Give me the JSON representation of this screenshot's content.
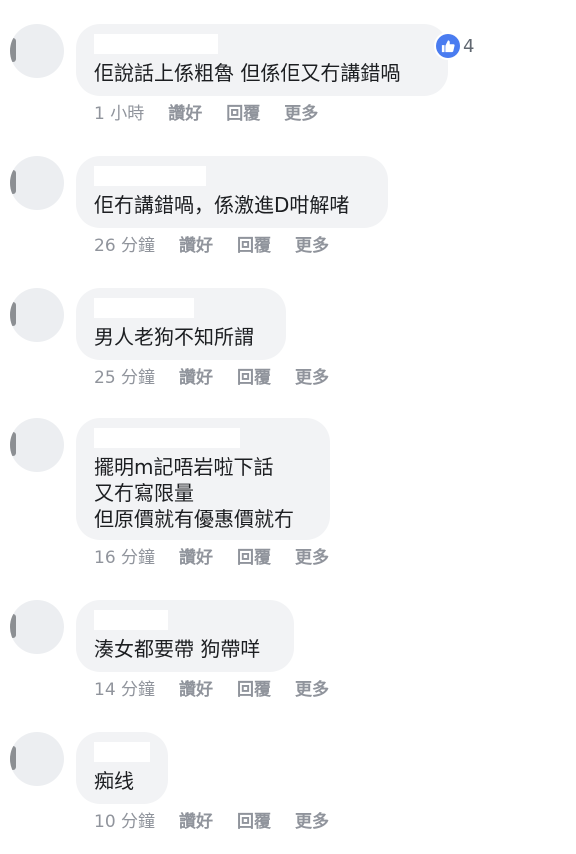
{
  "comments": [
    {
      "lines": [
        "佢說話上係粗魯 但係佢又冇講錯喎"
      ],
      "time": "1 小時",
      "like": "讚好",
      "reply": "回覆",
      "more": "更多",
      "reactions": {
        "icon": "thumbs-up-icon",
        "count": "4",
        "color": "#4a7cf0"
      }
    },
    {
      "lines": [
        "佢冇講錯喎，係激進D咁解啫"
      ],
      "time": "26 分鐘",
      "like": "讚好",
      "reply": "回覆",
      "more": "更多"
    },
    {
      "lines": [
        "男人老狗不知所謂"
      ],
      "time": "25 分鐘",
      "like": "讚好",
      "reply": "回覆",
      "more": "更多"
    },
    {
      "lines": [
        "擺明m記唔岩啦下話",
        "又冇寫限量",
        "但原價就有優惠價就冇"
      ],
      "time": "16 分鐘",
      "like": "讚好",
      "reply": "回覆",
      "more": "更多"
    },
    {
      "lines": [
        "湊女都要帶 狗帶咩"
      ],
      "time": "14 分鐘",
      "like": "讚好",
      "reply": "回覆",
      "more": "更多"
    },
    {
      "lines": [
        "痴线"
      ],
      "time": "10 分鐘",
      "like": "讚好",
      "reply": "回覆",
      "more": "更多"
    }
  ],
  "colors": {
    "bubble": "#f2f3f5",
    "text": "#1c1e21",
    "meta": "#90949c",
    "like_blue": "#4a7cf0"
  }
}
